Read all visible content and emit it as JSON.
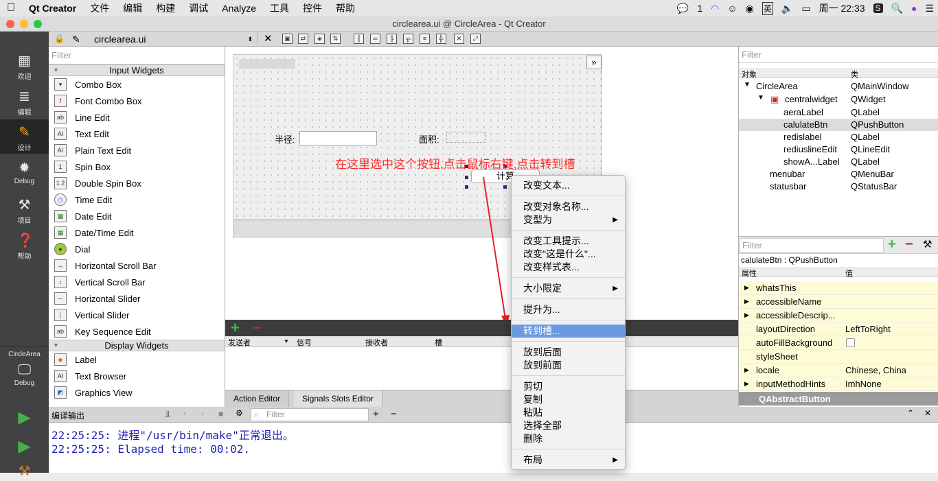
{
  "menubar": {
    "apple": "",
    "app": "Qt Creator",
    "items": [
      "文件",
      "编辑",
      "构建",
      "调试",
      "Analyze",
      "工具",
      "控件",
      "帮助"
    ],
    "wechat_count": "1",
    "ime": "英",
    "clock": "周一 22:33"
  },
  "window_title": "circlearea.ui @ CircleArea - Qt Creator",
  "modes": [
    {
      "label": "欢迎",
      "icon": "grid-icon"
    },
    {
      "label": "编辑",
      "icon": "document-icon"
    },
    {
      "label": "设计",
      "icon": "pencil-icon"
    },
    {
      "label": "Debug",
      "icon": "bug-icon"
    },
    {
      "label": "项目",
      "icon": "wrench-icon"
    },
    {
      "label": "帮助",
      "icon": "help-icon"
    }
  ],
  "kit": {
    "project": "CircleArea",
    "config": "Debug"
  },
  "toolbar": {
    "file": "circlearea.ui"
  },
  "widgetbox": {
    "filter_placeholder": "Filter",
    "categories": [
      "Input Widgets",
      "Display Widgets"
    ],
    "input_widgets": [
      "Combo Box",
      "Font Combo Box",
      "Line Edit",
      "Text Edit",
      "Plain Text Edit",
      "Spin Box",
      "Double Spin Box",
      "Time Edit",
      "Date Edit",
      "Date/Time Edit",
      "Dial",
      "Horizontal Scroll Bar",
      "Vertical Scroll Bar",
      "Horizontal Slider",
      "Vertical Slider",
      "Key Sequence Edit"
    ],
    "display_widgets": [
      "Label",
      "Text Browser",
      "Graphics View"
    ]
  },
  "form": {
    "radius_label": "半径:",
    "area_label": "面积:",
    "calc_button": "计算",
    "more": "»",
    "annotation": "在这里选中这个按钮,点击鼠标右键,点击转到槽"
  },
  "signal_editor": {
    "columns": [
      "发送者",
      "信号",
      "接收者",
      "槽"
    ],
    "tabs": [
      "Action Editor",
      "Signals  Slots Editor"
    ]
  },
  "object_inspector": {
    "filter_placeholder": "Filter",
    "col_object": "对象",
    "col_class": "类",
    "rows": [
      {
        "name": "CircleArea",
        "cls": "QMainWindow"
      },
      {
        "name": "centralwidget",
        "cls": "QWidget"
      },
      {
        "name": "aeraLabel",
        "cls": "QLabel"
      },
      {
        "name": "calulateBtn",
        "cls": "QPushButton"
      },
      {
        "name": "redislabel",
        "cls": "QLabel"
      },
      {
        "name": "rediuslineEdit",
        "cls": "QLineEdit"
      },
      {
        "name": "showA...Label",
        "cls": "QLabel"
      },
      {
        "name": "menubar",
        "cls": "QMenuBar"
      },
      {
        "name": "statusbar",
        "cls": "QStatusBar"
      }
    ]
  },
  "property_editor": {
    "filter_placeholder": "Filter",
    "object_title": "calulateBtn : QPushButton",
    "col_property": "属性",
    "col_value": "值",
    "rows": [
      {
        "name": "whatsThis",
        "value": "",
        "expand": true
      },
      {
        "name": "accessibleName",
        "value": "",
        "expand": true
      },
      {
        "name": "accessibleDescrip...",
        "value": "",
        "expand": true
      },
      {
        "name": "layoutDirection",
        "value": "LeftToRight",
        "expand": false
      },
      {
        "name": "autoFillBackground",
        "value": "",
        "expand": false
      },
      {
        "name": "styleSheet",
        "value": "",
        "expand": false
      },
      {
        "name": "locale",
        "value": "Chinese, China",
        "expand": true
      },
      {
        "name": "inputMethodHints",
        "value": "ImhNone",
        "expand": true
      }
    ],
    "section": "QAbstractButton"
  },
  "output": {
    "title": "编译输出",
    "filter_placeholder": "Filter",
    "lines": [
      "22:25:25: 进程\"/usr/bin/make\"正常退出。",
      "22:25:25: Elapsed time: 00:02."
    ]
  },
  "context_menu": {
    "items": [
      "改变文本...",
      "改变对象名称...",
      "变型为",
      "改变工具提示...",
      "改变\"这是什么\"...",
      "改变样式表...",
      "大小限定",
      "提升为...",
      "转到槽...",
      "放到后面",
      "放到前面",
      "剪切",
      "复制",
      "粘贴",
      "选择全部",
      "删除",
      "布局"
    ],
    "selected": "转到槽..."
  }
}
